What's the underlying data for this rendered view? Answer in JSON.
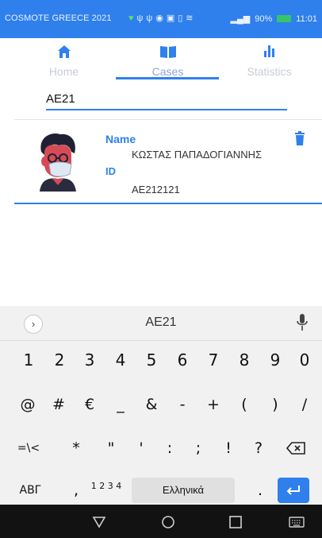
{
  "status_bar": {
    "carrier": "COSMOTE GREECE 2021",
    "battery": "90%",
    "time": "11:01"
  },
  "tabs": [
    {
      "label": "Home",
      "icon": "home-icon"
    },
    {
      "label": "Cases",
      "icon": "book-icon"
    },
    {
      "label": "Statistics",
      "icon": "bar-chart-icon"
    }
  ],
  "active_tab": "Cases",
  "search": {
    "value": "AE21",
    "placeholder": ""
  },
  "case": {
    "name_label": "Name",
    "name_value": "ΚΩΣΤΑΣ ΠΑΠΑΔΟΓΙΑΝΝΗΣ",
    "id_label": "ID",
    "id_value": "AE212121"
  },
  "keyboard": {
    "suggestion": "AE21",
    "row_numbers": [
      "1",
      "2",
      "3",
      "4",
      "5",
      "6",
      "7",
      "8",
      "9",
      "0"
    ],
    "row_symbols1": [
      "@",
      "#",
      "€",
      "_",
      "&",
      "-",
      "+",
      "(",
      ")",
      "/"
    ],
    "row_symbols2_left": "=\\<",
    "row_symbols2": [
      "*",
      "\"",
      "'",
      ":",
      ";",
      "!",
      "?"
    ],
    "bottom": {
      "alpha": "ΑΒΓ",
      "comma": ",",
      "numpad": "1 2 3 4",
      "space": "Ελληνικά",
      "period": "."
    }
  },
  "colors": {
    "accent": "#2f80ed",
    "status_bar": "#2f80ed",
    "nav_bar": "#121212"
  }
}
